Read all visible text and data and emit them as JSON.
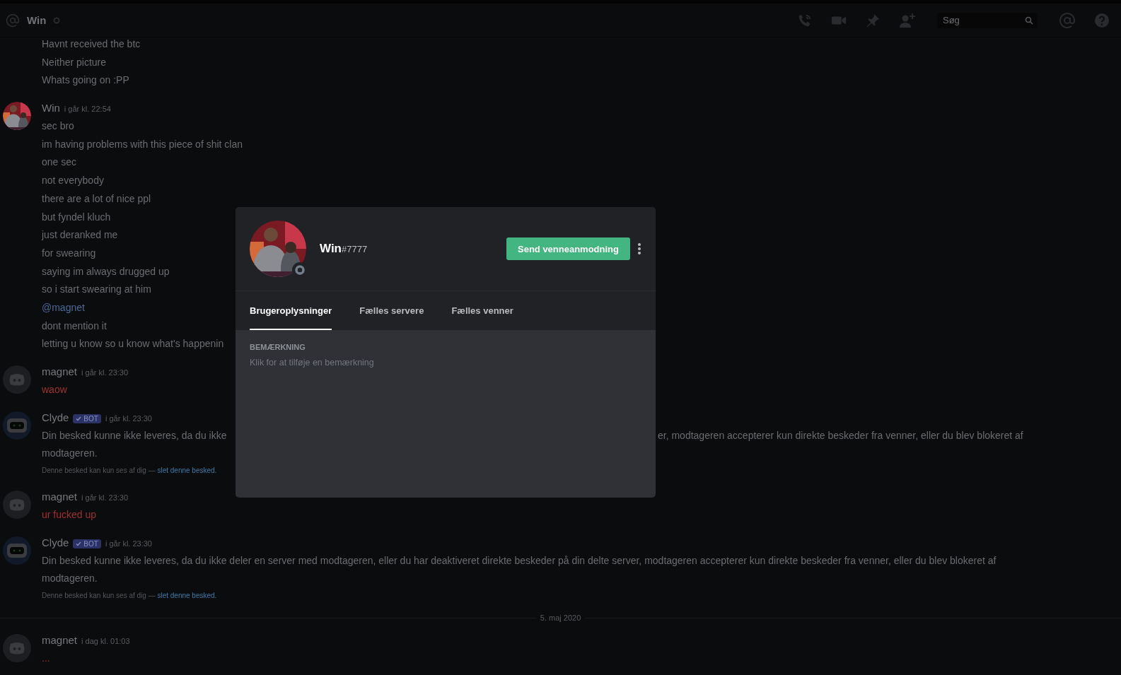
{
  "header": {
    "channel": "Win",
    "search": {
      "placeholder": "Søg"
    }
  },
  "messages": [
    {
      "kind": "continuation",
      "lines": [
        {
          "kind": "plain",
          "text": "Havnt received the btc"
        },
        {
          "kind": "plain",
          "text": "Neither picture"
        },
        {
          "kind": "plain",
          "text": "Whats going on :PP"
        }
      ]
    },
    {
      "kind": "user",
      "author": "Win",
      "time": "i går kl. 22:54",
      "lines": [
        {
          "kind": "plain",
          "text": "sec bro"
        },
        {
          "kind": "plain",
          "text": "im having problems with this piece of shit clan"
        },
        {
          "kind": "plain",
          "text": "one sec"
        },
        {
          "kind": "plain",
          "text": "not everybody"
        },
        {
          "kind": "plain",
          "text": "there are a lot of nice ppl"
        },
        {
          "kind": "plain",
          "text": "but fyndel kluch"
        },
        {
          "kind": "plain",
          "text": "just deranked me"
        },
        {
          "kind": "plain",
          "text": "for swearing"
        },
        {
          "kind": "plain",
          "text": "saying im always drugged up"
        },
        {
          "kind": "plain",
          "text": "so i start swearing at him"
        },
        {
          "kind": "mention",
          "text": "@magnet"
        },
        {
          "kind": "plain",
          "text": "dont mention it"
        },
        {
          "kind": "plain",
          "text": "letting u know so u know what's happenin"
        }
      ]
    },
    {
      "kind": "user",
      "avatar": {
        "kind": "discord"
      },
      "author": "magnet",
      "time": "i går kl. 23:30",
      "lines": [
        {
          "kind": "red",
          "text": "waow"
        }
      ]
    },
    {
      "kind": "bot",
      "avatar": {
        "kind": "bot"
      },
      "author": "Clyde",
      "badge": "BOT",
      "time": "i går kl. 23:30",
      "lines": [
        {
          "kind": "split",
          "text": "Din besked kunne ikke leveres, da du ikke",
          "rest": "er, modtageren accepterer kun direkte beskeder fra venner, eller du blev blokeret af"
        },
        {
          "kind": "plain",
          "text": "modtageren."
        }
      ],
      "note": "Denne besked kan kun ses af dig —",
      "link": "slet denne besked."
    },
    {
      "kind": "user",
      "avatar": {
        "kind": "discord"
      },
      "author": "magnet",
      "time": "i går kl. 23:30",
      "lines": [
        {
          "kind": "red",
          "text": "ur fucked up"
        }
      ]
    },
    {
      "kind": "bot",
      "avatar": {
        "kind": "bot"
      },
      "author": "Clyde",
      "badge": "BOT",
      "time": "i går kl. 23:30",
      "lines": [
        {
          "kind": "plain",
          "text": "Din besked kunne ikke leveres, da du ikke deler en server med modtageren, eller du har deaktiveret direkte beskeder på din delte server, modtageren accepterer kun direkte beskeder fra venner, eller du blev blokeret af"
        },
        {
          "kind": "plain",
          "text": "modtageren."
        }
      ],
      "note": "Denne besked kan kun ses af dig —",
      "link": "slet denne besked."
    },
    {
      "kind": "divider",
      "text": "5. maj 2020"
    },
    {
      "kind": "user",
      "avatar": {
        "kind": "discord"
      },
      "author": "magnet",
      "time": "i dag kl. 01:03",
      "lines": [
        {
          "kind": "red",
          "text": "..."
        }
      ]
    }
  ],
  "profile": {
    "username": "Win",
    "discriminator": "#7777",
    "button": "Send venneanmodning",
    "tabs": [
      {
        "label": "Brugeroplysninger",
        "selected": true
      },
      {
        "label": "Fælles servere",
        "selected": false
      },
      {
        "label": "Fælles venner",
        "selected": false
      }
    ],
    "note_label": "BEMÆRKNING",
    "note": {
      "placeholder": "Klik for at tilføje en bemærkning"
    }
  }
}
